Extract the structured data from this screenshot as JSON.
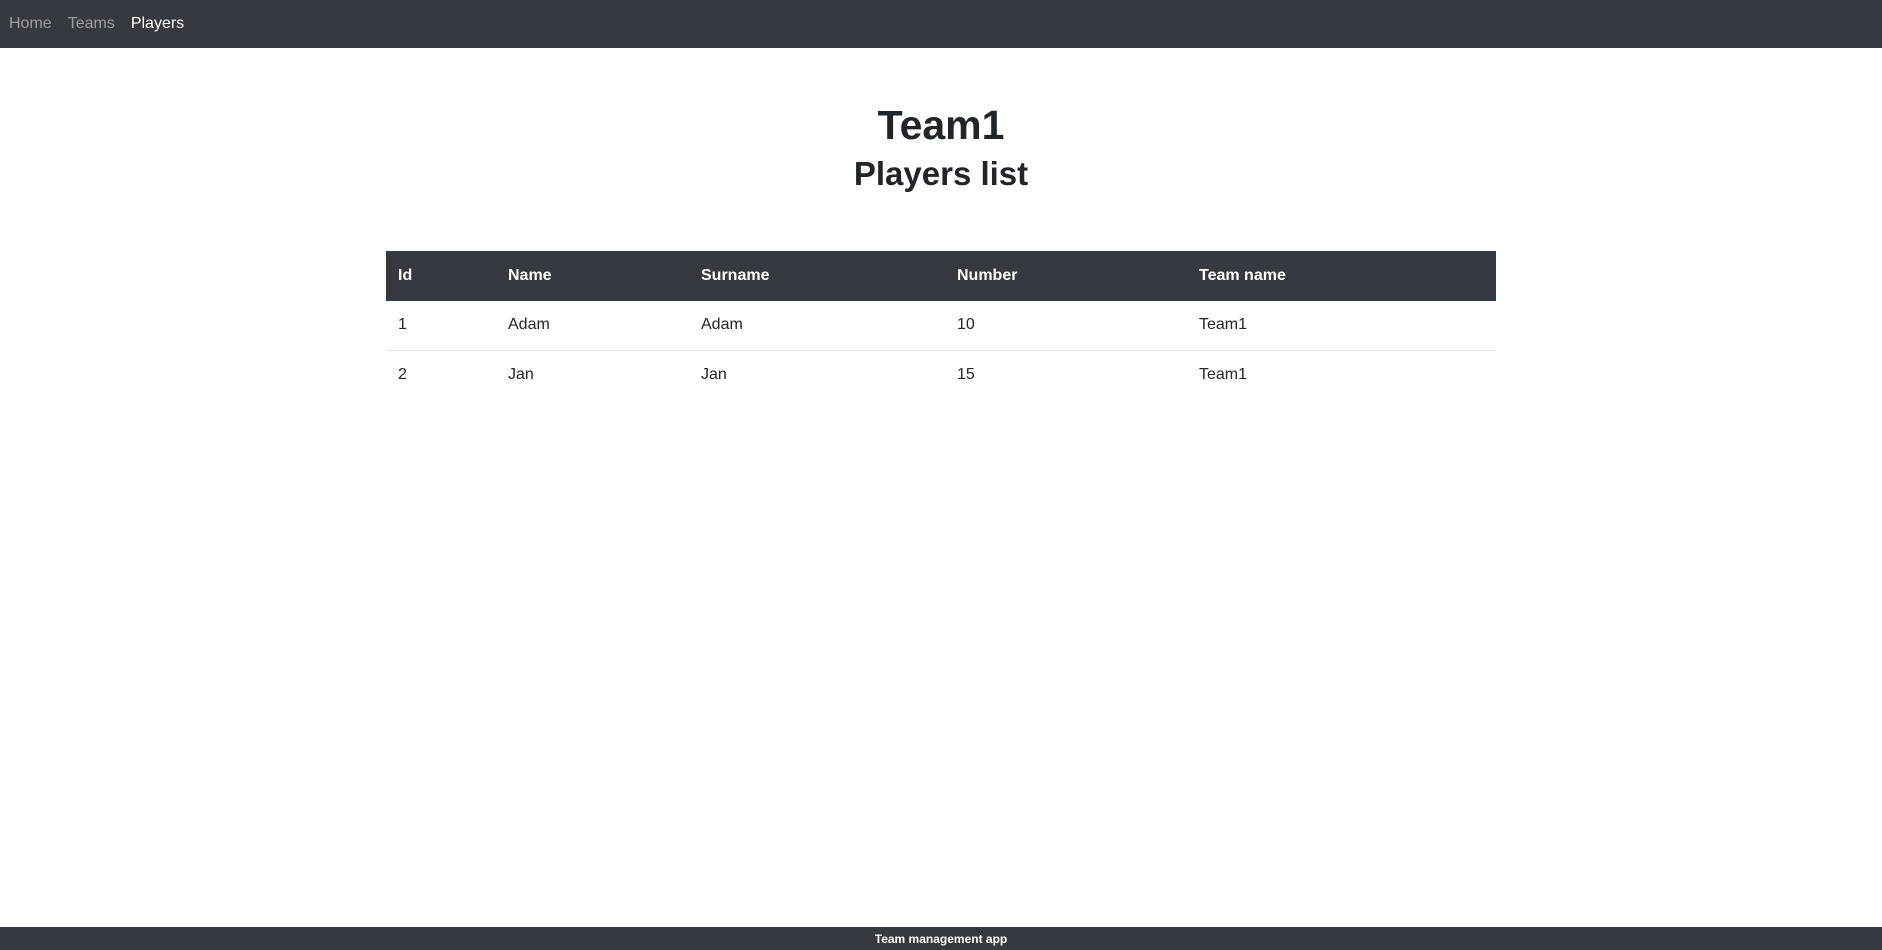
{
  "nav": {
    "items": [
      {
        "label": "Home"
      },
      {
        "label": "Teams"
      },
      {
        "label": "Players"
      }
    ],
    "active": "Players"
  },
  "page": {
    "title": "Team1",
    "subtitle": "Players list"
  },
  "table": {
    "headers": [
      "Id",
      "Name",
      "Surname",
      "Number",
      "Team name"
    ],
    "rows": [
      [
        "1",
        "Adam",
        "Adam",
        "10",
        "Team1"
      ],
      [
        "2",
        "Jan",
        "Jan",
        "15",
        "Team1"
      ]
    ]
  },
  "footer": {
    "text": "Team management app"
  }
}
